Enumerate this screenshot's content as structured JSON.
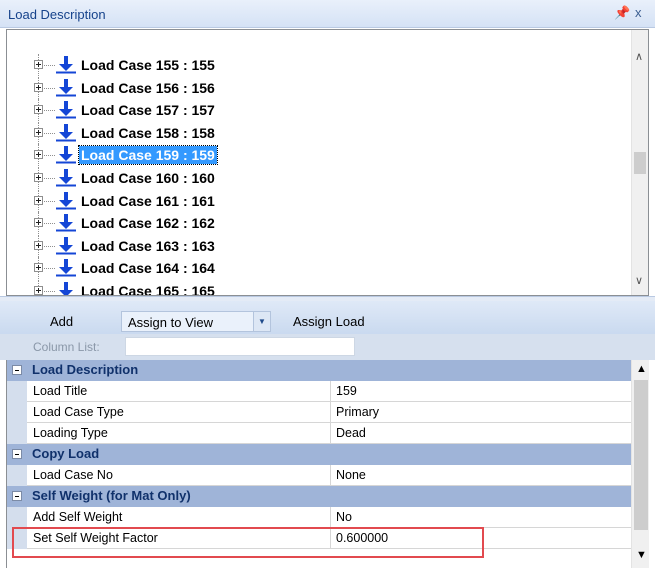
{
  "window": {
    "title": "Load Description",
    "pin_glyph": "p",
    "close_glyph": "x"
  },
  "tree": {
    "items": [
      {
        "label": "Load Case 155 : 155",
        "icon": "down-arrow-icon",
        "selected": false
      },
      {
        "label": "Load Case 156 : 156",
        "icon": "down-arrow-icon",
        "selected": false
      },
      {
        "label": "Load Case 157 : 157",
        "icon": "down-arrow-icon",
        "selected": false
      },
      {
        "label": "Load Case 158 : 158",
        "icon": "down-arrow-icon",
        "selected": false
      },
      {
        "label": "Load Case 159 : 159",
        "icon": "down-arrow-icon",
        "selected": true
      },
      {
        "label": "Load Case 160 : 160",
        "icon": "down-arrow-icon",
        "selected": false
      },
      {
        "label": "Load Case 161 : 161",
        "icon": "down-arrow-icon",
        "selected": false
      },
      {
        "label": "Load Case 162 : 162",
        "icon": "down-arrow-icon",
        "selected": false
      },
      {
        "label": "Load Case 163 : 163",
        "icon": "down-arrow-icon",
        "selected": false
      },
      {
        "label": "Load Case 164 : 164",
        "icon": "down-arrow-icon",
        "selected": false
      },
      {
        "label": "Load Case 165 : 165",
        "icon": "down-arrow-icon",
        "selected": false
      }
    ]
  },
  "toolbar": {
    "add_label": "Add",
    "assign_combo_value": "Assign to View",
    "assign_load_label": "Assign Load"
  },
  "column_list": {
    "label": "Column List:",
    "value": ""
  },
  "property_grid": {
    "categories": [
      {
        "label": "Load Description",
        "properties": [
          {
            "name": "Load Title",
            "value": "159"
          },
          {
            "name": "Load Case Type",
            "value": "Primary"
          },
          {
            "name": "Loading Type",
            "value": "Dead"
          }
        ]
      },
      {
        "label": "Copy Load",
        "properties": [
          {
            "name": "Load Case No",
            "value": "None"
          }
        ]
      },
      {
        "label": "Self Weight (for Mat Only)",
        "properties": [
          {
            "name": "Add Self Weight",
            "value": "No"
          },
          {
            "name": "Set Self Weight Factor",
            "value": "0.600000"
          }
        ]
      }
    ]
  },
  "colors": {
    "selection": "#3399ff",
    "icon_blue": "#1446d6",
    "category_band": "#9fb4d8",
    "highlight_box": "#e24a4f"
  }
}
